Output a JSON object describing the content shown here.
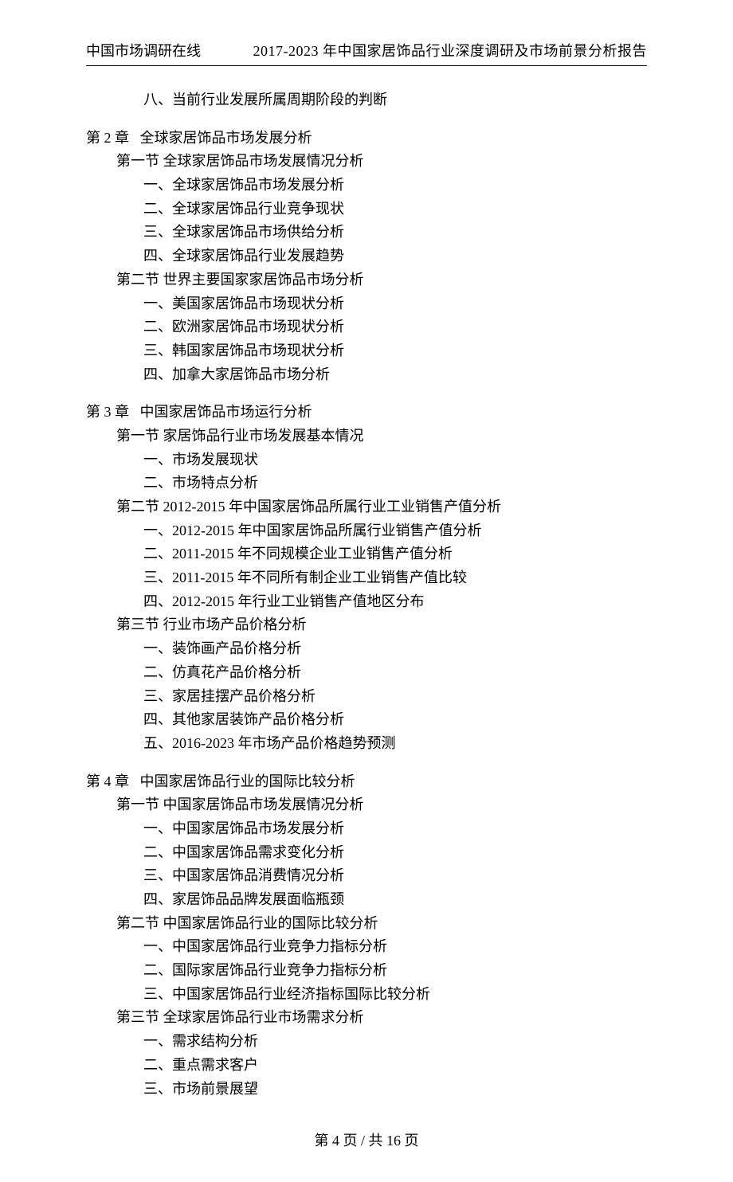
{
  "header": {
    "left": "中国市场调研在线",
    "right": "2017-2023 年中国家居饰品行业深度调研及市场前景分析报告"
  },
  "orphan_line": "八、当前行业发展所属周期阶段的判断",
  "chapters": [
    {
      "title": "第 2 章   全球家居饰品市场发展分析",
      "sections": [
        {
          "title": "第一节 全球家居饰品市场发展情况分析",
          "items": [
            "一、全球家居饰品市场发展分析",
            "二、全球家居饰品行业竞争现状",
            "三、全球家居饰品市场供给分析",
            "四、全球家居饰品行业发展趋势"
          ]
        },
        {
          "title": "第二节 世界主要国家家居饰品市场分析",
          "items": [
            "一、美国家居饰品市场现状分析",
            "二、欧洲家居饰品市场现状分析",
            "三、韩国家居饰品市场现状分析",
            "四、加拿大家居饰品市场分析"
          ]
        }
      ]
    },
    {
      "title": "第 3 章   中国家居饰品市场运行分析",
      "sections": [
        {
          "title": "第一节 家居饰品行业市场发展基本情况",
          "items": [
            "一、市场发展现状",
            "二、市场特点分析"
          ]
        },
        {
          "title": "第二节 2012-2015 年中国家居饰品所属行业工业销售产值分析",
          "items": [
            "一、2012-2015 年中国家居饰品所属行业销售产值分析",
            "二、2011-2015 年不同规模企业工业销售产值分析",
            "三、2011-2015 年不同所有制企业工业销售产值比较",
            "四、2012-2015 年行业工业销售产值地区分布"
          ]
        },
        {
          "title": "第三节 行业市场产品价格分析",
          "items": [
            "一、装饰画产品价格分析",
            "二、仿真花产品价格分析",
            "三、家居挂摆产品价格分析",
            "四、其他家居装饰产品价格分析",
            "五、2016-2023 年市场产品价格趋势预测"
          ]
        }
      ]
    },
    {
      "title": "第 4 章   中国家居饰品行业的国际比较分析",
      "sections": [
        {
          "title": "第一节 中国家居饰品市场发展情况分析",
          "items": [
            "一、中国家居饰品市场发展分析",
            "二、中国家居饰品需求变化分析",
            "三、中国家居饰品消费情况分析",
            "四、家居饰品品牌发展面临瓶颈"
          ]
        },
        {
          "title": "第二节 中国家居饰品行业的国际比较分析",
          "items": [
            "一、中国家居饰品行业竞争力指标分析",
            "二、国际家居饰品行业竞争力指标分析",
            "三、中国家居饰品行业经济指标国际比较分析"
          ]
        },
        {
          "title": "第三节 全球家居饰品行业市场需求分析",
          "items": [
            "一、需求结构分析",
            "二、重点需求客户",
            "三、市场前景展望"
          ]
        }
      ]
    }
  ],
  "footer": {
    "prefix": "第 ",
    "current": "4",
    "mid": " 页 / 共 ",
    "total": "16",
    "suffix": " 页"
  }
}
